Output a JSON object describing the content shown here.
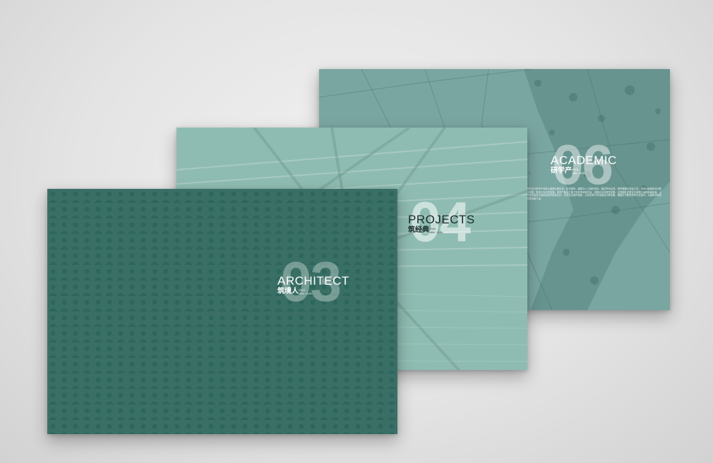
{
  "cards": {
    "academic": {
      "number": "06",
      "title": "ACADEMIC",
      "subtitle_cn": "研学产",
      "meta_year": "2015",
      "meta_period": "JAN.~JUN.",
      "body_text": "筑境设计研学产体系从建筑实践出发，探讨城市、建筑与人之间的关系。通过学术交流、研究课题与出版工作，将设计经验转化为知识积累，推动行业共同发展。研学产板块汇集了历年学术研讨会、讲座论坛与研究成果，记录团队在理论与实践之间的持续探索。以开放的姿态与高校及研究机构合作，共同关注城市更新、文化传承与可持续设计等议题，期望在不断的思考与对话中，为建筑学科的发展贡献力量。",
      "color": "#7aa6a2"
    },
    "projects": {
      "number": "04",
      "title": "PROJECTS",
      "subtitle_cn": "筑经典",
      "meta_year": "2015",
      "meta_period": "JAN.~JUN.",
      "color": "#8fbcb2"
    },
    "architect": {
      "number": "03",
      "title": "ARCHITECT",
      "subtitle_cn": "筑境人",
      "meta_year": "2015",
      "meta_period": "JAN.~JUN.",
      "color": "#3a6f65"
    }
  }
}
